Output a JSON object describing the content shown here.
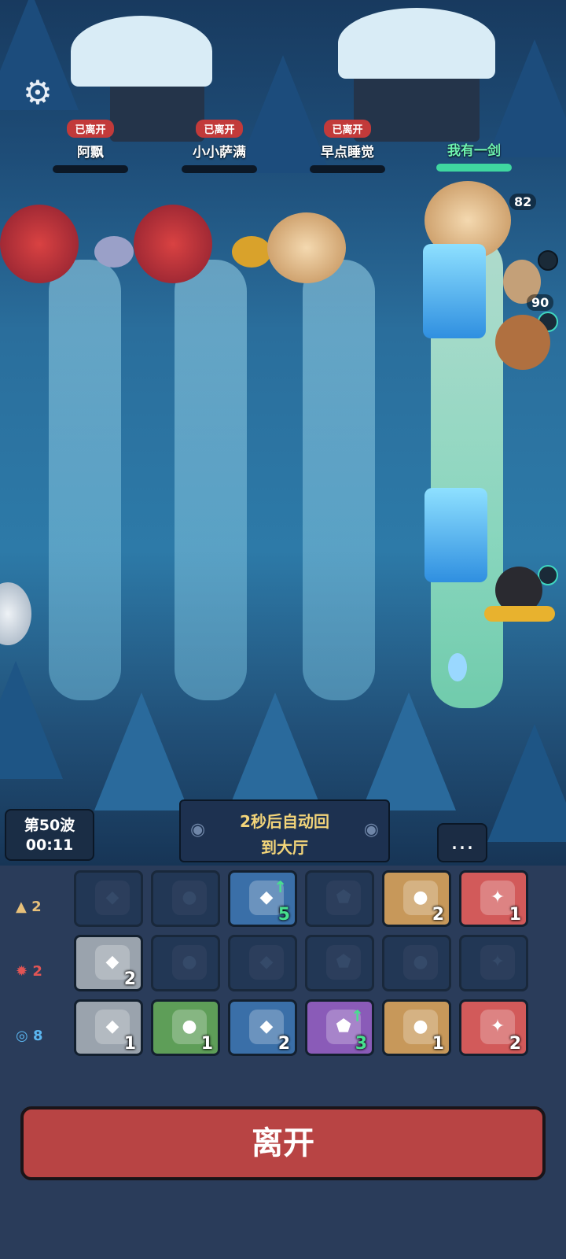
{
  "players": [
    {
      "status": "已离开",
      "name": "阿飘"
    },
    {
      "status": "已离开",
      "name": "小小萨满"
    },
    {
      "status": "已离开",
      "name": "早点睡觉"
    },
    {
      "status": "",
      "name": "我有一剑",
      "hp_fraction": 1.0
    }
  ],
  "battle": {
    "boss_hp": "82",
    "unit_hp": "90"
  },
  "wave": {
    "label": "第50波",
    "timer": "00:11"
  },
  "banner": {
    "line1": "2秒后自动回",
    "line2": "到大厅"
  },
  "icons": {
    "settings": "gear-icon",
    "chat": "chat-bubble-icon",
    "eye": "eye-icon"
  },
  "elements": [
    {
      "count": "2",
      "color": "#e7c07a",
      "slots": [
        {
          "filled": false,
          "count": ""
        },
        {
          "filled": false,
          "count": ""
        },
        {
          "filled": true,
          "bg": "#3a6fa8",
          "count": "5",
          "upgrade": true
        },
        {
          "filled": false,
          "count": ""
        },
        {
          "filled": true,
          "bg": "#c7985a",
          "count": "2"
        },
        {
          "filled": true,
          "bg": "#d25a5a",
          "count": "1"
        }
      ]
    },
    {
      "count": "2",
      "color": "#e25555",
      "slots": [
        {
          "filled": true,
          "bg": "#9aa3ad",
          "count": "2"
        },
        {
          "filled": false,
          "count": ""
        },
        {
          "filled": false,
          "count": ""
        },
        {
          "filled": false,
          "count": ""
        },
        {
          "filled": false,
          "count": ""
        },
        {
          "filled": false,
          "count": ""
        }
      ]
    },
    {
      "count": "8",
      "color": "#5bb6f0",
      "slots": [
        {
          "filled": true,
          "bg": "#9aa3ad",
          "count": "1"
        },
        {
          "filled": true,
          "bg": "#5e9e58",
          "count": "1"
        },
        {
          "filled": true,
          "bg": "#3a6fa8",
          "count": "2"
        },
        {
          "filled": true,
          "bg": "#8a5bb8",
          "count": "3",
          "upgrade": true
        },
        {
          "filled": true,
          "bg": "#c7985a",
          "count": "1"
        },
        {
          "filled": true,
          "bg": "#d25a5a",
          "count": "2"
        }
      ]
    }
  ],
  "leave_button": "离开"
}
